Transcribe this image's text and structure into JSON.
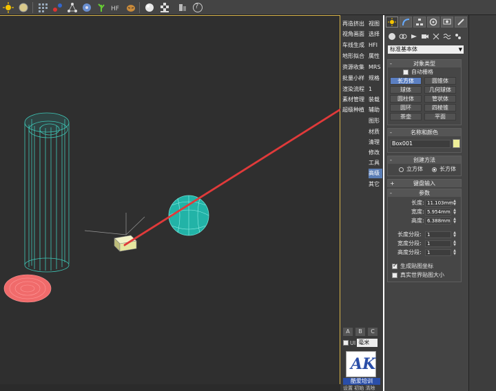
{
  "colors": {
    "accent_selected": "#5b7fc2",
    "arrow_red": "#e03a3a",
    "cylinder_teal": "#3fc8b8",
    "sphere_teal": "#22b3a7",
    "spiral_red": "#f06b6b",
    "box_yellow": "#e6e6a0",
    "viewport_border": "#d9b54a",
    "color_swatch": "#eeee99"
  },
  "toolbar": {
    "icons": [
      "sun-icon",
      "sphere-light-icon",
      "grid-icon",
      "particles-icon",
      "molecule-icon",
      "compass-icon",
      "gear-leaf-icon",
      "fur-icon",
      "tiger-icon",
      "teapot-icon",
      "sphere-icon",
      "checkerboard-icon",
      "slice-icon",
      "help-icon"
    ],
    "help_glyph": "?"
  },
  "plugin": {
    "rows": [
      {
        "c1": "再造挤出",
        "c2": "视图"
      },
      {
        "c1": "视角画面",
        "c2": "选择"
      },
      {
        "c1": "车线生成",
        "c2": "HFI"
      },
      {
        "c1": "地形拟合",
        "c2": "属性"
      },
      {
        "c1": "资源收集",
        "c2": "MRS"
      },
      {
        "c1": "批量小样",
        "c2": "规格"
      },
      {
        "c1": "渲染流程",
        "c2": "1"
      },
      {
        "c1": "素材管理",
        "c2": "装载"
      },
      {
        "c1": "超级种植",
        "c2": "辅助"
      }
    ],
    "singles": [
      "图形",
      "材质",
      "清理",
      "修改",
      "工具",
      "高级",
      "其它"
    ],
    "active_single": "高级",
    "tabs": [
      "A",
      "B",
      "C"
    ],
    "ui_label": "UI",
    "unit_value": "毫米",
    "logo_text": "AK",
    "logo_caption": "酷爱培训",
    "bottom_caption": "设置 初始 清除"
  },
  "cmd": {
    "category_value": "标准基本体",
    "object_type": {
      "title": "对象类型",
      "auto_grid": "自动栅格",
      "buttons": [
        "长方体",
        "圆锥体",
        "球体",
        "几何球体",
        "圆柱体",
        "管状体",
        "圆环",
        "四棱锥",
        "茶壶",
        "平面"
      ],
      "active": "长方体"
    },
    "name_color": {
      "title": "名称和颜色",
      "name_value": "Box001"
    },
    "creation": {
      "title": "创建方法",
      "opt1": "立方体",
      "opt2": "长方体"
    },
    "keyboard": {
      "title": "键盘输入",
      "sign": "+"
    },
    "params": {
      "title": "参数",
      "length_label": "长度:",
      "length_value": "11.103mm",
      "width_label": "宽度:",
      "width_value": "5.954mm",
      "height_label": "高度:",
      "height_value": "6.388mm",
      "lseg_label": "长度分段:",
      "lseg_value": "1",
      "wseg_label": "宽度分段:",
      "wseg_value": "1",
      "hseg_label": "高度分段:",
      "hseg_value": "1",
      "gen_map": "生成贴图坐标",
      "real_world": "真实世界贴图大小"
    },
    "minus": "-"
  }
}
